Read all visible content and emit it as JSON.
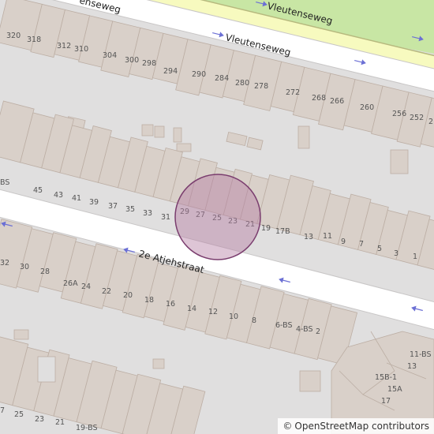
{
  "map": {
    "colors": {
      "background": "#e0dfdf",
      "road_fill": "#ffffff",
      "road_casing": "#c8c6c6",
      "main_road_fill": "#f7fabf",
      "main_road_casing": "#b7b97e",
      "green": "#c8e6a4",
      "building_fill": "#d9d0c9",
      "building_stroke": "#bcaea4",
      "oneway_arrow": "#6c70d5",
      "route_line": "#2a2ad1",
      "marker_fill": "#b57ea5",
      "marker_stroke": "#7a3d6e"
    },
    "streets": {
      "vleutenseweg_north": "Vleutenseweg",
      "vleutenseweg": "Vleutenseweg",
      "atjehstraat": "2e Atjehstraat",
      "fragment_topleft": "enseweg"
    },
    "house_numbers": {
      "north_row": [
        "320",
        "318",
        "312",
        "310",
        "304",
        "300",
        "298",
        "294",
        "290",
        "284",
        "280",
        "278",
        "272",
        "268",
        "266",
        "260",
        "256",
        "252",
        "2"
      ],
      "middle_row": [
        "BS",
        "45",
        "43",
        "41",
        "39",
        "37",
        "35",
        "33",
        "31",
        "29",
        "27",
        "25",
        "23",
        "21",
        "19",
        "17B",
        "13",
        "11",
        "9",
        "7",
        "5",
        "3",
        "1"
      ],
      "south_row": [
        "32",
        "30",
        "28",
        "26A",
        "24",
        "22",
        "20",
        "18",
        "16",
        "14",
        "12",
        "10",
        "8",
        "6-BS",
        "4-BS",
        "2"
      ],
      "bottom_row": [
        "7",
        "25",
        "23",
        "21",
        "19-BS"
      ],
      "bottom_right": [
        "11-BS",
        "13",
        "15B-1",
        "15A",
        "17"
      ]
    },
    "marker": {
      "type": "location-circle"
    }
  },
  "attribution": {
    "symbol": "©",
    "text": "OpenStreetMap contributors"
  }
}
